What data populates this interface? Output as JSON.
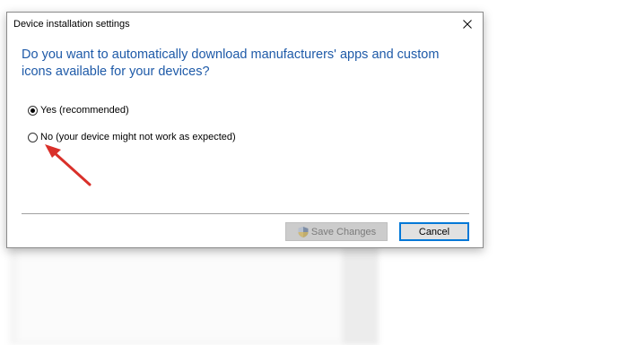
{
  "dialog": {
    "title": "Device installation settings",
    "close_glyph": "✕",
    "question": "Do you want to automatically download manufacturers' apps and custom icons available for your devices?",
    "options": [
      {
        "label": "Yes (recommended)",
        "selected": true
      },
      {
        "label": "No (your device might not work as expected)",
        "selected": false
      }
    ],
    "buttons": {
      "save_label": "Save Changes",
      "save_enabled": false,
      "cancel_label": "Cancel"
    }
  },
  "icons": {
    "close": "close-icon",
    "shield": "uac-shield-icon",
    "annotation": "red-arrow-annotation"
  },
  "colors": {
    "question_text": "#1e5aa8",
    "focus_border": "#0078d7",
    "arrow": "#d9302a"
  }
}
